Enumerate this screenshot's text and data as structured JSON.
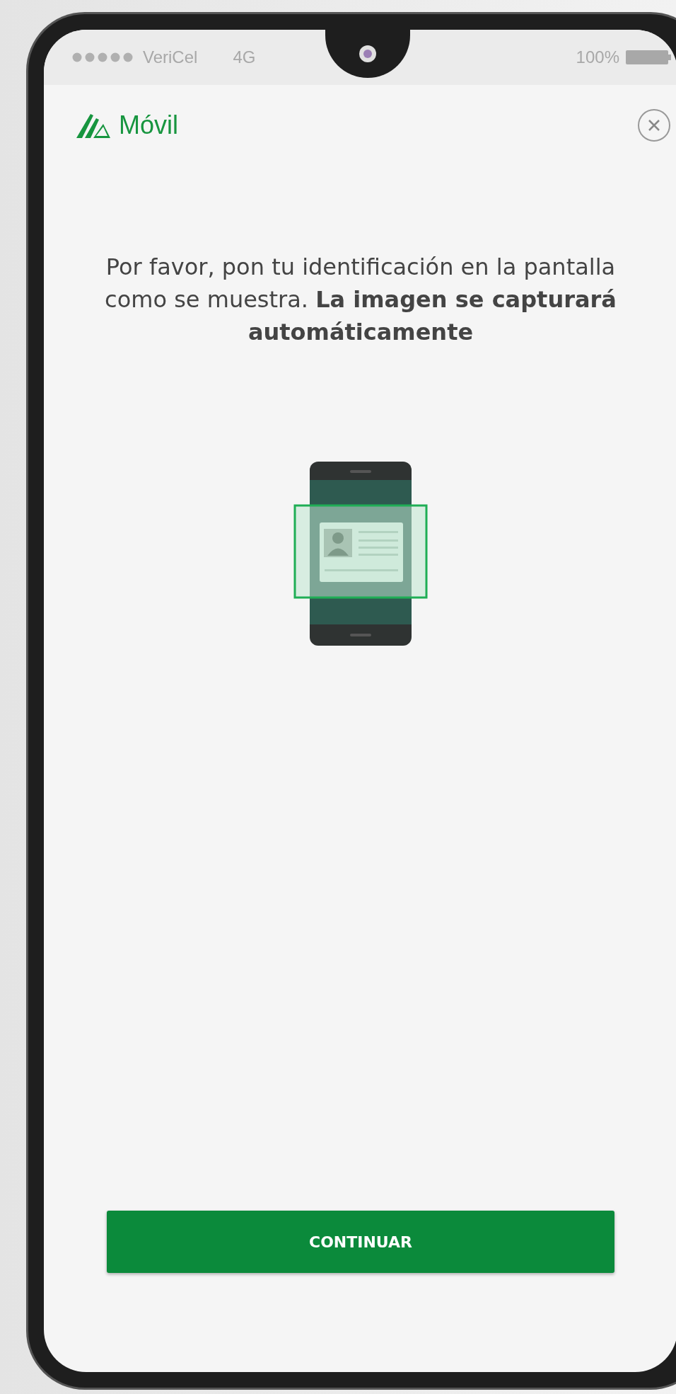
{
  "status_bar": {
    "carrier": "VeriCel",
    "network": "4G",
    "battery": "100%"
  },
  "header": {
    "brand": "Móvil"
  },
  "instruction": "Por favor, pon tu identificación en la pantalla como se muestra. **La imagen se capturará automáticamente**",
  "button": {
    "label": "CONTINUAR"
  }
}
